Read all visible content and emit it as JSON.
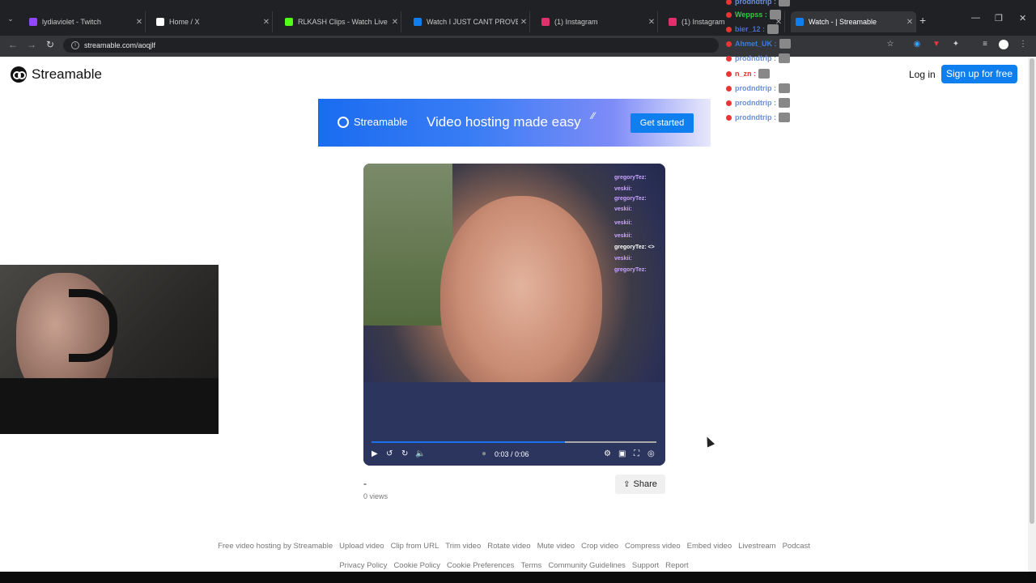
{
  "browser": {
    "tabs": [
      {
        "title": "lydiaviolet - Twitch",
        "color": "#9146ff"
      },
      {
        "title": "Home / X",
        "color": "#ffffff"
      },
      {
        "title": "RLKASH Clips - Watch Live on K",
        "color": "#53fc18"
      },
      {
        "title": "Watch I JUST CANT PROVE IT | S",
        "color": "#0f7ff0"
      },
      {
        "title": "(1) Instagram",
        "color": "#e1306c"
      },
      {
        "title": "(1) Instagram",
        "color": "#e1306c"
      },
      {
        "title": "Watch - | Streamable",
        "color": "#0f7ff0"
      }
    ],
    "url": "streamable.com/aoqjlf"
  },
  "header": {
    "brand": "Streamable",
    "login": "Log in",
    "signup": "Sign up for free"
  },
  "banner": {
    "brand": "Streamable",
    "tagline": "Video hosting made easy",
    "cta": "Get started"
  },
  "player": {
    "time": "0:03 / 0:06",
    "progress_fraction": 0.68,
    "chat_overlay": [
      {
        "user": "gregoryTez:",
        "color": "#c9a3ff"
      },
      {
        "user": "veskii:",
        "color": "#c9a3ff"
      },
      {
        "user": "gregoryTez:",
        "color": "#c9a3ff"
      },
      {
        "user": "veskii:",
        "color": "#c9a3ff"
      },
      {
        "user": "veskii:",
        "color": "#c9a3ff"
      },
      {
        "user": "veskii:",
        "color": "#c9a3ff"
      },
      {
        "user": "gregoryTez: <>",
        "color": "#ffffff"
      },
      {
        "user": "veskii:",
        "color": "#c9a3ff"
      },
      {
        "user": "gregoryTez:",
        "color": "#c9a3ff"
      }
    ]
  },
  "video_info": {
    "title": "-",
    "views": "0 views",
    "share": "Share"
  },
  "footer": {
    "row1": [
      "Free video hosting by Streamable",
      "Upload video",
      "Clip from URL",
      "Trim video",
      "Rotate video",
      "Mute video",
      "Crop video",
      "Compress video",
      "Embed video",
      "Livestream",
      "Podcast"
    ],
    "row2": [
      "Privacy Policy",
      "Cookie Policy",
      "Cookie Preferences",
      "Terms",
      "Community Guidelines",
      "Support",
      "Report"
    ]
  },
  "stream_chat": [
    {
      "user": "prodndtrip :",
      "color": "#6b8fd6"
    },
    {
      "user": "Weppss :",
      "color": "#2ecc40"
    },
    {
      "user": "bier_12 :",
      "color": "#4a6fd1"
    },
    {
      "user": "Ahmet_UK :",
      "color": "#3b7dd8"
    },
    {
      "user": "prodndtrip :",
      "color": "#6b8fd6"
    },
    {
      "user": "n_zn :",
      "color": "#e33333"
    },
    {
      "user": "prodndtrip :",
      "color": "#6b8fd6"
    },
    {
      "user": "prodndtrip :",
      "color": "#6b8fd6"
    },
    {
      "user": "prodndtrip :",
      "color": "#6b8fd6"
    }
  ]
}
